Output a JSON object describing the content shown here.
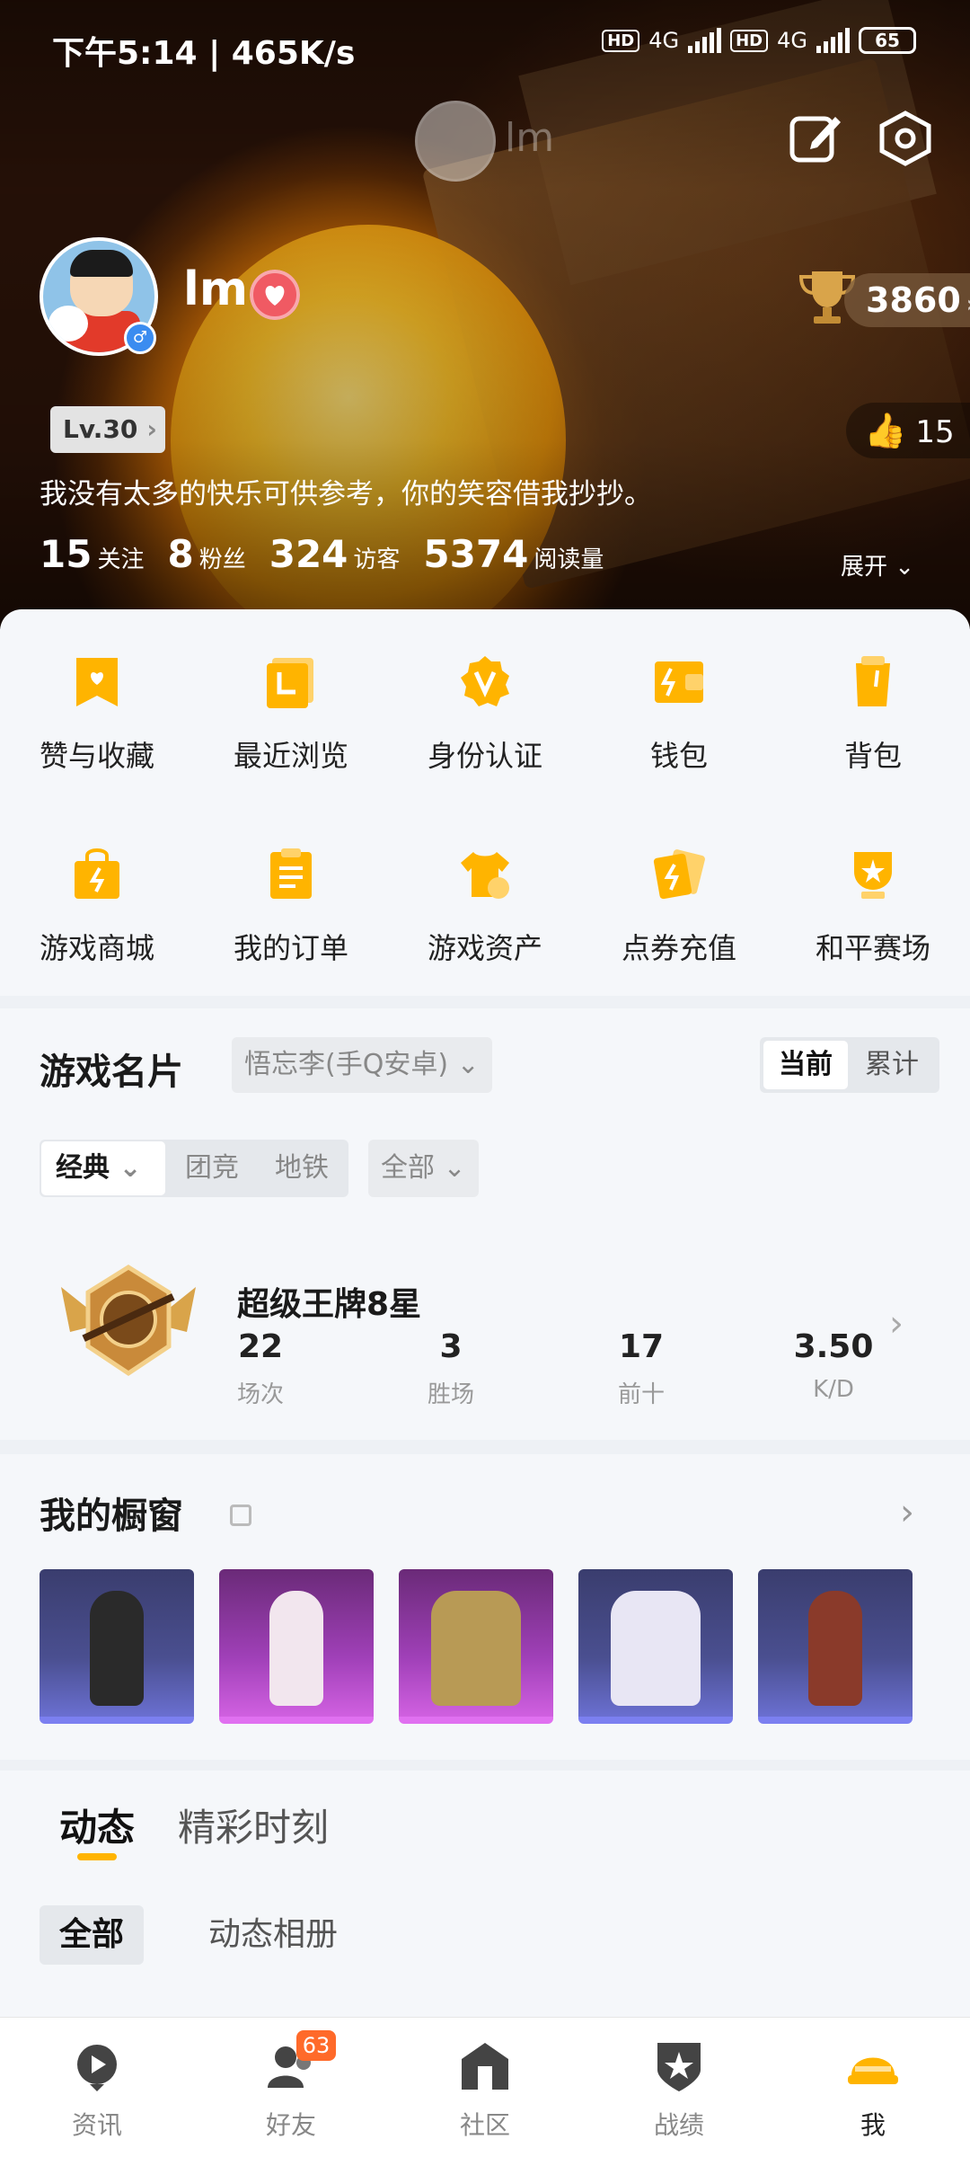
{
  "status_bar": {
    "time": "下午5:14 | 465K/s",
    "net_1": "4G",
    "net_2": "4G",
    "hd": "HD",
    "battery": "65"
  },
  "header": {
    "top_name": "lm"
  },
  "profile": {
    "username": "lm",
    "score": "3860",
    "level": "Lv.30",
    "likes": "15",
    "bio": "我没有太多的快乐可供参考，你的笑容借我抄抄。",
    "stats": [
      {
        "value": "15",
        "label": "关注"
      },
      {
        "value": "8",
        "label": "粉丝"
      },
      {
        "value": "324",
        "label": "访客"
      },
      {
        "value": "5374",
        "label": "阅读量"
      }
    ],
    "expand_label": "展开"
  },
  "menu": [
    {
      "label": "赞与收藏",
      "icon": "bookmark-heart-icon"
    },
    {
      "label": "最近浏览",
      "icon": "history-icon"
    },
    {
      "label": "身份认证",
      "icon": "verified-v-icon"
    },
    {
      "label": "钱包",
      "icon": "wallet-icon"
    },
    {
      "label": "背包",
      "icon": "backpack-icon"
    },
    {
      "label": "游戏商城",
      "icon": "shopping-bag-icon"
    },
    {
      "label": "我的订单",
      "icon": "order-list-icon"
    },
    {
      "label": "游戏资产",
      "icon": "outfit-icon"
    },
    {
      "label": "点券充值",
      "icon": "coupon-icon"
    },
    {
      "label": "和平赛场",
      "icon": "arena-cup-icon"
    }
  ],
  "game_card": {
    "title": "游戏名片",
    "account": "悟忘李(手Q安卓)",
    "segment_current": "当前",
    "segment_total": "累计",
    "mode_selected": "经典",
    "mode_team": "团竞",
    "mode_metro": "地铁",
    "scope": "全部",
    "rank_name": "超级王牌8星",
    "stats": [
      {
        "value": "22",
        "label": "场次"
      },
      {
        "value": "3",
        "label": "胜场"
      },
      {
        "value": "17",
        "label": "前十"
      },
      {
        "value": "3.50",
        "label": "K/D"
      }
    ]
  },
  "showcase": {
    "title": "我的橱窗",
    "items": [
      {
        "rarity": "blue",
        "color": "#2a2a2a"
      },
      {
        "rarity": "pink",
        "color": "#f2e6ee"
      },
      {
        "rarity": "pink",
        "color": "#b89a55"
      },
      {
        "rarity": "blue",
        "color": "#e8e6f4"
      },
      {
        "rarity": "blue",
        "color": "#8a3a2a"
      }
    ]
  },
  "feed": {
    "tab_active": "动态",
    "tab_other": "精彩时刻",
    "chip_active": "全部",
    "chip_other": "动态相册"
  },
  "tabbar": {
    "badge": "63",
    "items": [
      {
        "label": "资讯",
        "icon": "news-play-icon"
      },
      {
        "label": "好友",
        "icon": "friends-icon"
      },
      {
        "label": "社区",
        "icon": "community-house-icon"
      },
      {
        "label": "战绩",
        "icon": "record-shield-icon"
      },
      {
        "label": "我",
        "icon": "helmet-icon"
      }
    ]
  },
  "colors": {
    "accent": "#ffb400",
    "badge": "#ff6a2a",
    "heart": "#f05a63"
  }
}
